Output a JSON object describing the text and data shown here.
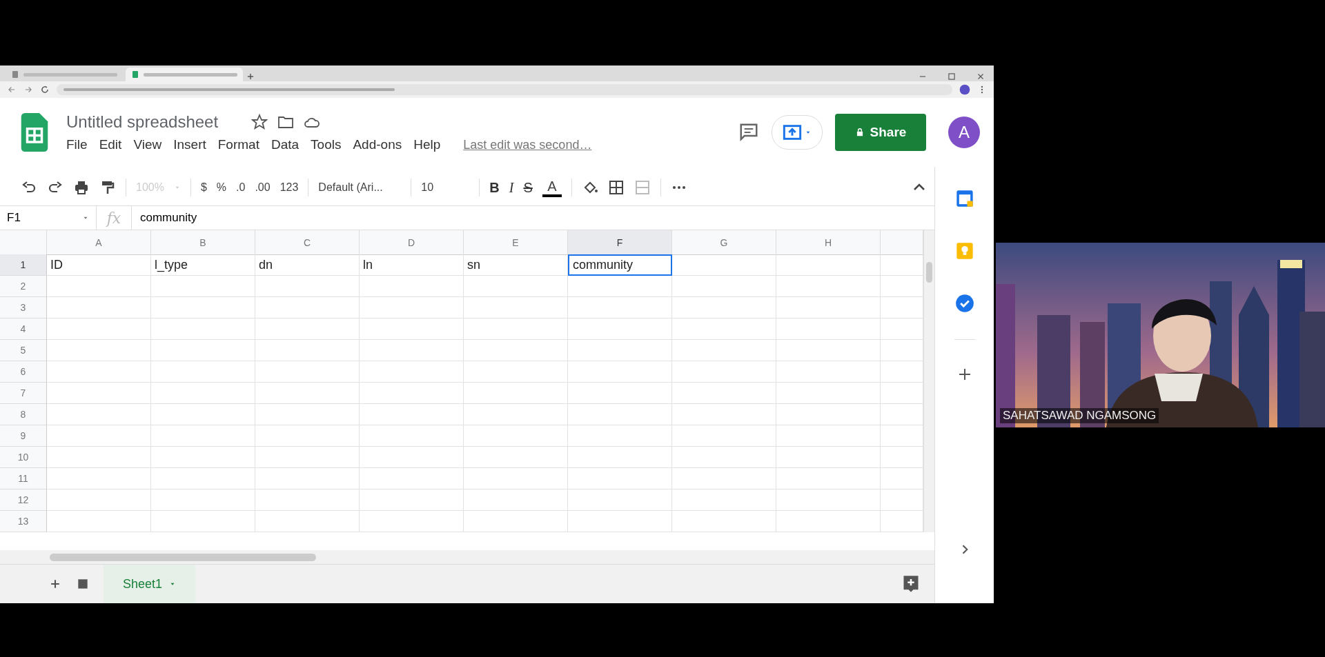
{
  "browser": {
    "tabs": [
      {
        "selected": false
      },
      {
        "selected": true
      }
    ]
  },
  "sheet": {
    "title": "Untitled spreadsheet",
    "menus": [
      "File",
      "Edit",
      "View",
      "Insert",
      "Format",
      "Data",
      "Tools",
      "Add-ons",
      "Help"
    ],
    "last_edit": "Last edit was second…",
    "share": "Share",
    "avatar": "A"
  },
  "toolbar": {
    "zoom": {
      "text": "100%",
      "disabled": true
    },
    "number_formats": [
      "$",
      "%",
      ".0",
      ".00",
      "123"
    ],
    "font": "Default (Ari...",
    "font_size": "10",
    "text_styles": [
      "B",
      "I",
      "S",
      "A"
    ]
  },
  "formula_bar": {
    "cell": "F1",
    "fx_label": "fx",
    "formula": "community"
  },
  "columns": [
    {
      "label": "A",
      "selected": false
    },
    {
      "label": "B",
      "selected": false
    },
    {
      "label": "C",
      "selected": false
    },
    {
      "label": "D",
      "selected": false
    },
    {
      "label": "E",
      "selected": false
    },
    {
      "label": "F",
      "selected": true
    },
    {
      "label": "G",
      "selected": false
    },
    {
      "label": "H",
      "selected": false
    }
  ],
  "rows": [
    {
      "label": "1",
      "selected": true,
      "cells": [
        {
          "text": "ID",
          "selected": false
        },
        {
          "text": "l_type",
          "selected": false
        },
        {
          "text": "dn",
          "selected": false
        },
        {
          "text": "ln",
          "selected": false
        },
        {
          "text": "sn",
          "selected": false
        },
        {
          "text": "community",
          "selected": true
        }
      ]
    },
    {
      "label": "2",
      "selected": false
    },
    {
      "label": "3",
      "selected": false
    },
    {
      "label": "4",
      "selected": false
    },
    {
      "label": "5",
      "selected": false
    },
    {
      "label": "6",
      "selected": false
    },
    {
      "label": "7",
      "selected": false
    },
    {
      "label": "8",
      "selected": false
    },
    {
      "label": "9",
      "selected": false
    },
    {
      "label": "10",
      "selected": false
    },
    {
      "label": "11",
      "selected": false
    },
    {
      "label": "12",
      "selected": false
    },
    {
      "label": "13",
      "selected": false
    }
  ],
  "sheet_tabs": [
    {
      "label": "Sheet1",
      "selected": true
    }
  ],
  "video": {
    "kind": "picture",
    "participant": "SAHATSAWAD NGAMSONG"
  }
}
